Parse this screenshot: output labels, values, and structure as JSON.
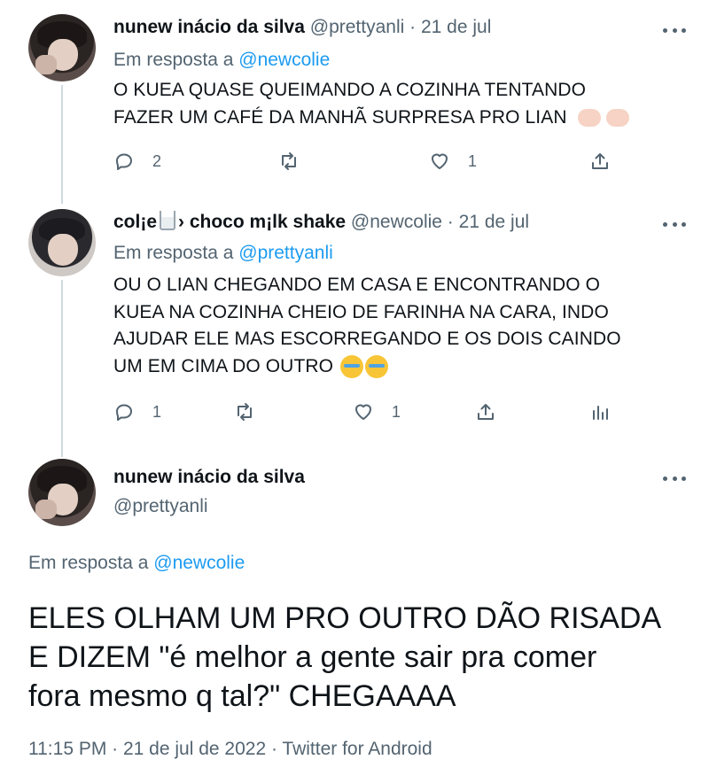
{
  "tweets": [
    {
      "name": "nunew inácio da silva",
      "handle": "@prettyanli",
      "date": "21 de jul",
      "reply_label": "Em resposta a",
      "reply_mention": "@newcolie",
      "text": "O KUEA QUASE QUEIMANDO A COZINHA TENTANDO\nFAZER UM CAFÉ DA MANHÃ SURPRESA PRO LIAN",
      "emoji": [
        "palm-hand-emoji",
        "palm-hand-emoji"
      ],
      "replies": "2",
      "likes": "1"
    },
    {
      "name_part1": "col¡e",
      "name_part2": "› choco m¡lk shake",
      "handle": "@newcolie",
      "date": "21 de jul",
      "reply_label": "Em resposta a",
      "reply_mention": "@prettyanli",
      "text": "OU O LIAN CHEGANDO EM CASA E ENCONTRANDO O\nKUEA NA COZINHA CHEIO  DE FARINHA NA CARA, INDO\nAJUDAR ELE MAS ESCORREGANDO E OS DOIS CAINDO\nUM EM CIMA DO OUTRO",
      "emoji": [
        "crying-face-emoji",
        "crying-face-emoji"
      ],
      "replies": "1",
      "likes": "1"
    }
  ],
  "main": {
    "name": "nunew inácio da silva",
    "handle": "@prettyanli",
    "reply_label": "Em resposta a",
    "reply_mention": "@newcolie",
    "text": "ELES OLHAM UM PRO OUTRO DÃO RISADA\nE DIZEM \"é melhor a gente sair pra comer\nfora mesmo q tal?\" CHEGAAAA",
    "meta": "11:15 PM · 21 de jul de 2022 · Twitter for Android"
  },
  "separator": "·",
  "colors": {
    "accent": "#1d9bf0",
    "muted": "#536471",
    "text": "#0f1419",
    "line": "#cfd9de"
  }
}
